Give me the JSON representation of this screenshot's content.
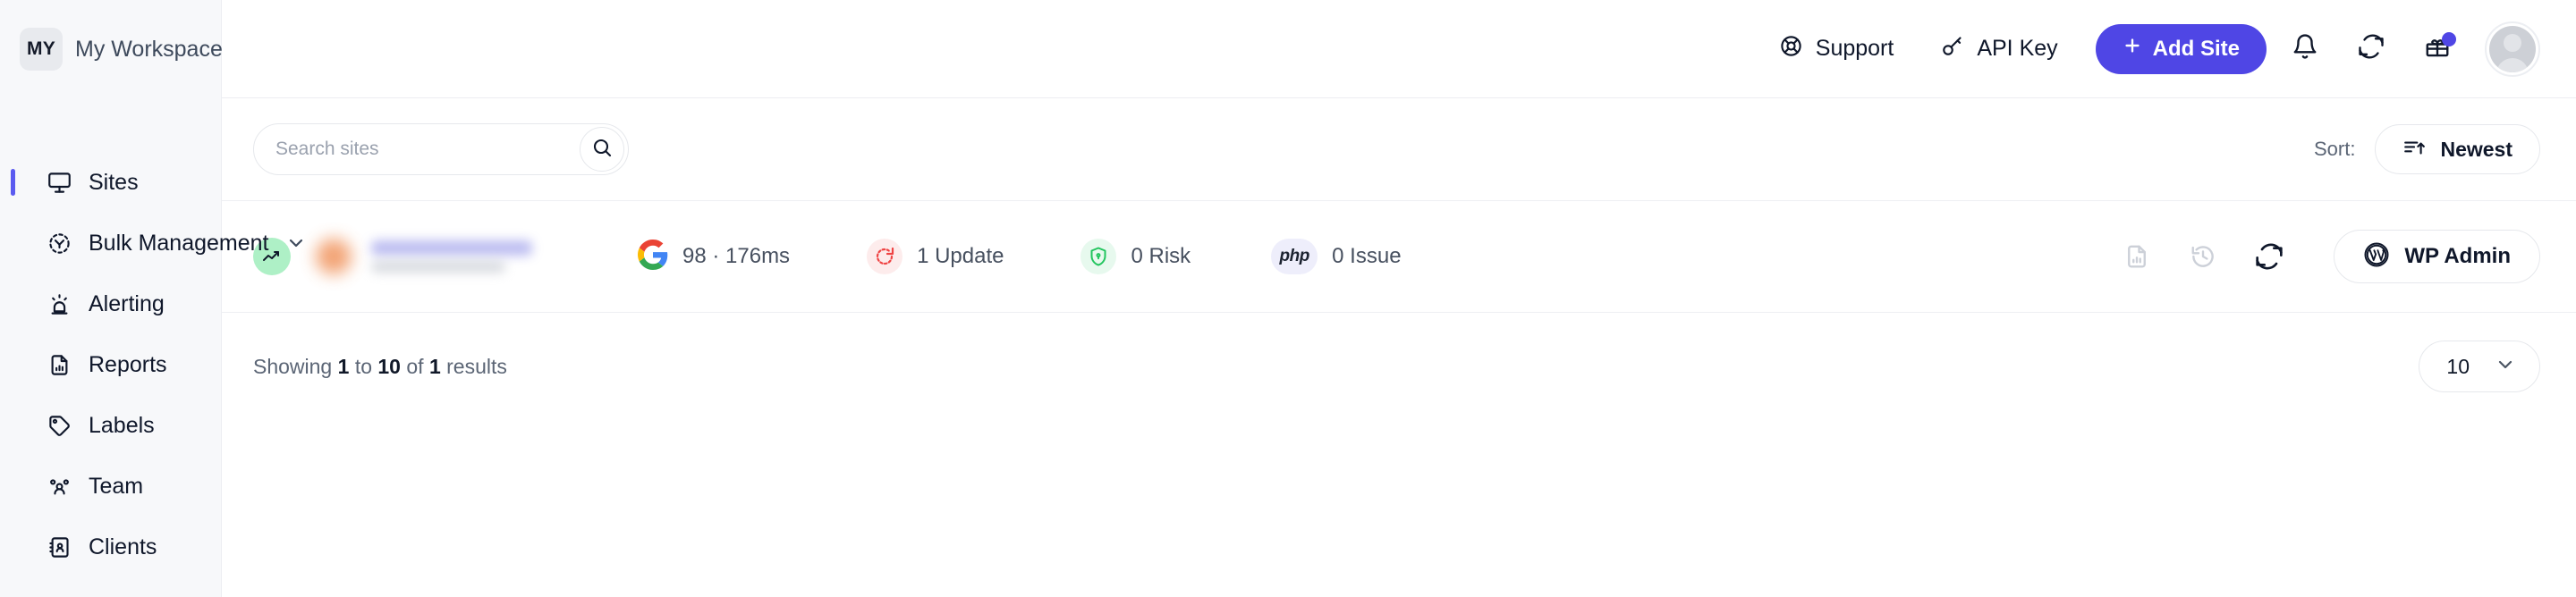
{
  "sidebar": {
    "workspace": {
      "initials": "MY",
      "name": "My Workspace",
      "chevron_icon": "chevron-down-icon",
      "settings_icon": "gear-icon"
    },
    "items": [
      {
        "label": "Sites",
        "icon": "monitor-icon",
        "active": true,
        "expandable": false
      },
      {
        "label": "Bulk Management",
        "icon": "network-icon",
        "active": false,
        "expandable": true
      },
      {
        "label": "Alerting",
        "icon": "siren-icon",
        "active": false,
        "expandable": false
      },
      {
        "label": "Reports",
        "icon": "report-doc-icon",
        "active": false,
        "expandable": false
      },
      {
        "label": "Labels",
        "icon": "tag-icon",
        "active": false,
        "expandable": false
      },
      {
        "label": "Team",
        "icon": "users-icon",
        "active": false,
        "expandable": false
      },
      {
        "label": "Clients",
        "icon": "contact-book-icon",
        "active": false,
        "expandable": false
      }
    ]
  },
  "topbar": {
    "support_label": "Support",
    "support_icon": "lifebuoy-icon",
    "api_key_label": "API Key",
    "api_key_icon": "key-icon",
    "add_site_label": "Add Site",
    "add_site_icon": "plus-icon",
    "notifications_icon": "bell-icon",
    "sync_icon": "refresh-icon",
    "gift_icon": "gift-icon",
    "gift_has_badge": true,
    "avatar_icon": "avatar-placeholder"
  },
  "toolbar": {
    "search_placeholder": "Search sites",
    "search_value": "",
    "search_button_icon": "search-icon",
    "sort_label": "Sort:",
    "sort_value": "Newest",
    "sort_icon": "sort-ascending-icon"
  },
  "site_row": {
    "trend_icon": "trending-up-icon",
    "favicon": "blurred-favicon",
    "site_name": "",
    "site_url": "",
    "metrics": [
      {
        "icon": "google-icon",
        "text": "98 · 176ms"
      },
      {
        "icon": "update-icon",
        "text": "1 Update"
      },
      {
        "icon": "shield-icon",
        "text": "0 Risk"
      },
      {
        "icon": "php-icon",
        "text": "0 Issue"
      }
    ],
    "actions": [
      {
        "icon": "report-file-icon",
        "state": "muted"
      },
      {
        "icon": "history-icon",
        "state": "muted"
      },
      {
        "icon": "sync-icon",
        "state": "active"
      }
    ],
    "wp_admin_label": "WP Admin",
    "wp_admin_icon": "wordpress-icon"
  },
  "footer": {
    "showing_prefix": "Showing",
    "showing_from": "1",
    "showing_to_word": "to",
    "showing_to": "10",
    "showing_of_word": "of",
    "showing_total": "1",
    "showing_suffix": "results",
    "per_page_value": "10",
    "per_page_chevron": "chevron-down-icon"
  },
  "colors": {
    "accent": "#4f46e5",
    "active_bar": "#5b5bf0",
    "risk_green": "#22c55e",
    "update_red": "#ef4444",
    "sidebar_bg": "#f7f8fa"
  }
}
